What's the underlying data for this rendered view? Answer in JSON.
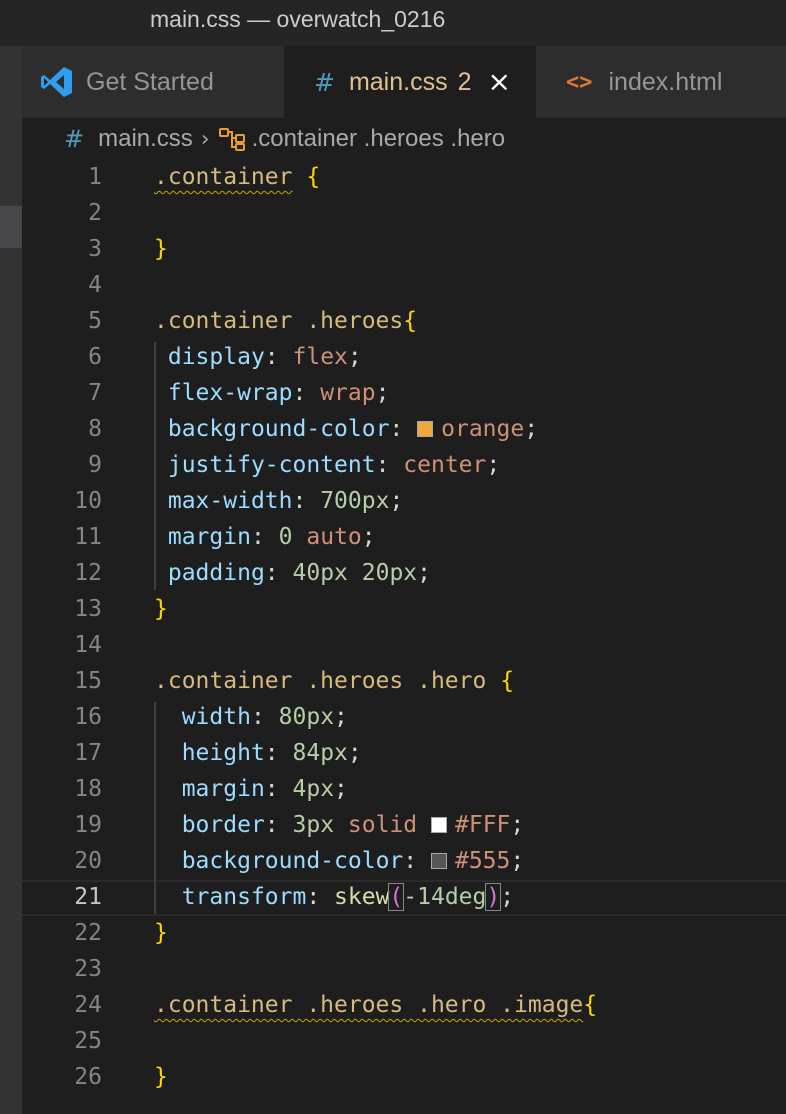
{
  "window": {
    "title": "main.css — overwatch_0216"
  },
  "tabs": [
    {
      "label": "Get Started",
      "icon": "vscode-logo-icon",
      "active": false
    },
    {
      "label": "main.css",
      "icon": "css-hash-icon",
      "problems": "2",
      "close": "×",
      "active": true
    },
    {
      "label": "index.html",
      "icon": "html-brackets-icon",
      "active": false
    }
  ],
  "breadcrumb": {
    "file": "main.css",
    "separator": "›",
    "symbol": ".container .heroes .hero"
  },
  "editor": {
    "active_line": 21,
    "colors": {
      "background": "#1e1e1e",
      "selector": "#d7ba7d",
      "property": "#9cdcfe",
      "value": "#ce9178",
      "number": "#b5cea8",
      "bracket": "#ffd700",
      "function": "#dcdcaa",
      "warning_squiggle": "#cca700"
    },
    "lines": [
      {
        "n": "1",
        "sel": ".container",
        "open": " {"
      },
      {
        "n": "2"
      },
      {
        "n": "3",
        "close": "}"
      },
      {
        "n": "4"
      },
      {
        "n": "5",
        "sel": ".container .heroes",
        "open": "{"
      },
      {
        "n": "6",
        "prop": "display",
        "value": "flex"
      },
      {
        "n": "7",
        "prop": "flex-wrap",
        "value": "wrap"
      },
      {
        "n": "8",
        "prop": "background-color",
        "value": "orange",
        "swatch": "#f0a83c"
      },
      {
        "n": "9",
        "prop": "justify-content",
        "value": "center"
      },
      {
        "n": "10",
        "prop": "max-width",
        "num": "700px"
      },
      {
        "n": "11",
        "prop": "margin",
        "num": "0",
        "value": "auto"
      },
      {
        "n": "12",
        "prop": "padding",
        "num": "40px",
        "num2": "20px"
      },
      {
        "n": "13",
        "close": "}"
      },
      {
        "n": "14"
      },
      {
        "n": "15",
        "sel": ".container .heroes .hero",
        "open": " {"
      },
      {
        "n": "16",
        "prop": "width",
        "num": "80px"
      },
      {
        "n": "17",
        "prop": "height",
        "num": "84px"
      },
      {
        "n": "18",
        "prop": "margin",
        "num": "4px"
      },
      {
        "n": "19",
        "prop": "border",
        "num": "3px",
        "value": "solid",
        "value2": "#FFF",
        "swatch": "#ffffff"
      },
      {
        "n": "20",
        "prop": "background-color",
        "value": "#555",
        "swatch": "#555555"
      },
      {
        "n": "21",
        "prop": "transform",
        "fn": "skew",
        "paren_open": "(",
        "arg": "-14deg",
        "paren_close": ")"
      },
      {
        "n": "22",
        "close": "}"
      },
      {
        "n": "23"
      },
      {
        "n": "24",
        "sel": ".container .heroes .hero .image",
        "open": "{"
      },
      {
        "n": "25"
      },
      {
        "n": "26",
        "close": "}"
      }
    ]
  }
}
